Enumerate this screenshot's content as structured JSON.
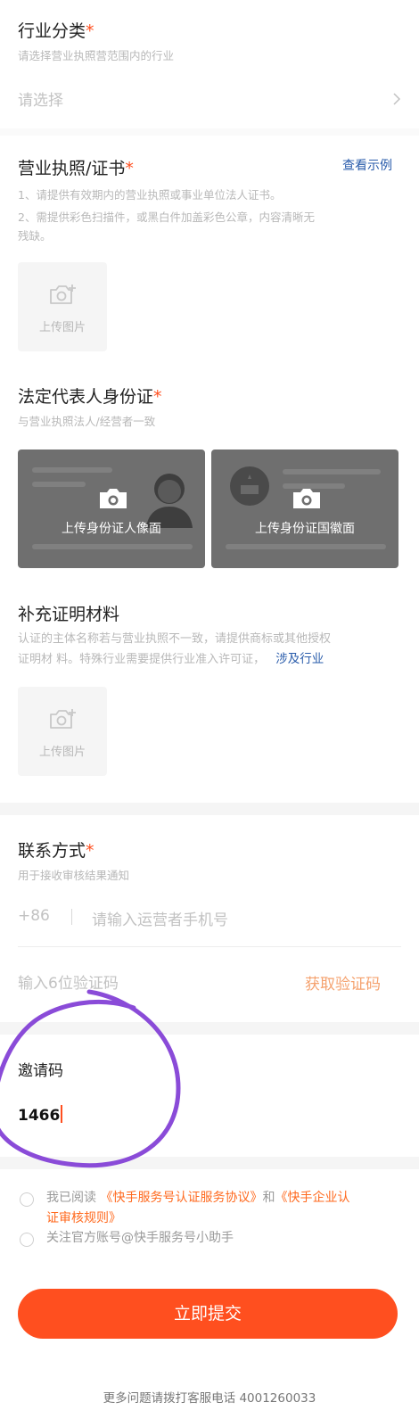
{
  "industry": {
    "title": "行业分类",
    "required_mark": "*",
    "hint": "请选择营业执照营范围内的行业",
    "select_placeholder": "请选择"
  },
  "license": {
    "title": "营业执照/证书",
    "required_mark": "*",
    "example_link": "查看示例",
    "hint_1": "1、请提供有效期内的营业执照或事业单位法人证书。",
    "hint_2a": "2、需提供彩色扫描件，或黑白件加盖彩色公章，内容清晰无",
    "hint_2b": "残缺。",
    "upload_label": "上传图片"
  },
  "legal_id": {
    "title": "法定代表人身份证",
    "required_mark": "*",
    "hint": "与营业执照法人/经营者一致",
    "portrait_label": "上传身份证人像面",
    "emblem_label": "上传身份证国徽面"
  },
  "supplement": {
    "title": "补充证明材料",
    "hint_1": "认证的主体名称若与营业执照不一致，请提供商标或其他授权",
    "hint_2": "证明材 料。特殊行业需要提供行业准入许可证，",
    "industry_link": "涉及行业",
    "upload_label": "上传图片"
  },
  "contact": {
    "title": "联系方式",
    "required_mark": "*",
    "hint": "用于接收审核结果通知",
    "country_code": "+86",
    "phone_placeholder": "请输入运营者手机号",
    "code_placeholder": "输入6位验证码",
    "get_code": "获取验证码"
  },
  "invite": {
    "title": "邀请码",
    "value": "1466"
  },
  "agreements": {
    "read_prefix": "我已阅读",
    "agreement_1": "《快手服务号认证服务协议》",
    "and": "和",
    "agreement_2a": "《快手企业认",
    "agreement_2b": "证审核规则》",
    "follow": "关注官方账号@快手服务号小助手"
  },
  "submit_label": "立即提交",
  "footer": "更多问题请拨打客服电话 4001260033",
  "colors": {
    "accent": "#ff4f1f",
    "link": "#2a5cab",
    "annotation": "#8a4bd8"
  }
}
